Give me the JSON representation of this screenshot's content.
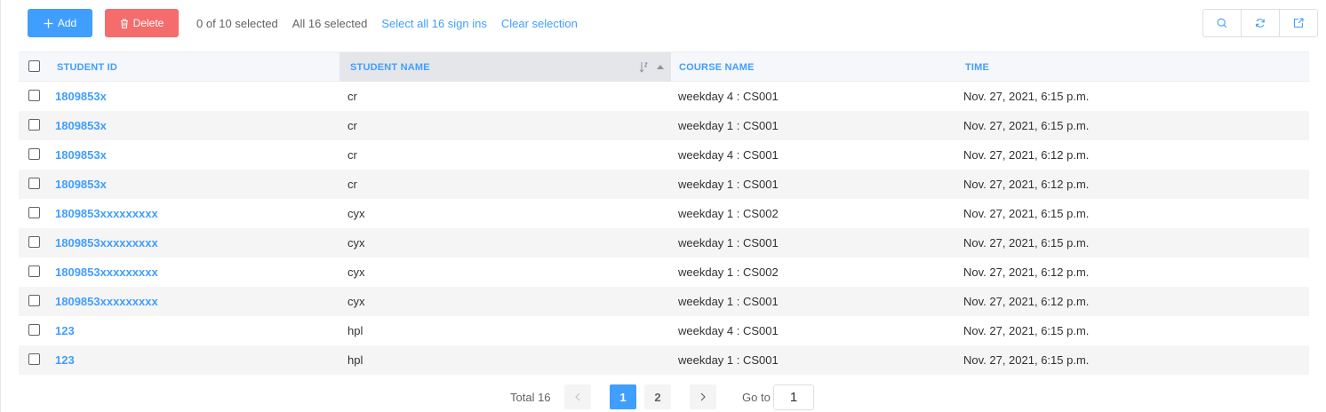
{
  "toolbar": {
    "add_label": "Add",
    "delete_label": "Delete",
    "selected_text": "0 of 10 selected",
    "all_selected_text": "All 16 selected",
    "select_all_link": "Select all 16 sign ins",
    "clear_link": "Clear selection",
    "tools": [
      "search-icon",
      "refresh-icon",
      "export-icon"
    ]
  },
  "table": {
    "columns": [
      "STUDENT ID",
      "STUDENT NAME",
      "COURSE NAME",
      "TIME"
    ],
    "sorted_column": "STUDENT NAME",
    "rows": [
      {
        "id": "1809853x",
        "name": "cr",
        "course": "weekday 4 : CS001",
        "time": "Nov. 27, 2021, 6:15 p.m."
      },
      {
        "id": "1809853x",
        "name": "cr",
        "course": "weekday 1 : CS001",
        "time": "Nov. 27, 2021, 6:15 p.m."
      },
      {
        "id": "1809853x",
        "name": "cr",
        "course": "weekday 4 : CS001",
        "time": "Nov. 27, 2021, 6:12 p.m."
      },
      {
        "id": "1809853x",
        "name": "cr",
        "course": "weekday 1 : CS001",
        "time": "Nov. 27, 2021, 6:12 p.m."
      },
      {
        "id": "1809853xxxxxxxxx",
        "name": "cyx",
        "course": "weekday 1 : CS002",
        "time": "Nov. 27, 2021, 6:15 p.m."
      },
      {
        "id": "1809853xxxxxxxxx",
        "name": "cyx",
        "course": "weekday 1 : CS001",
        "time": "Nov. 27, 2021, 6:15 p.m."
      },
      {
        "id": "1809853xxxxxxxxx",
        "name": "cyx",
        "course": "weekday 1 : CS002",
        "time": "Nov. 27, 2021, 6:12 p.m."
      },
      {
        "id": "1809853xxxxxxxxx",
        "name": "cyx",
        "course": "weekday 1 : CS001",
        "time": "Nov. 27, 2021, 6:12 p.m."
      },
      {
        "id": "123",
        "name": "hpl",
        "course": "weekday 4 : CS001",
        "time": "Nov. 27, 2021, 6:15 p.m."
      },
      {
        "id": "123",
        "name": "hpl",
        "course": "weekday 1 : CS001",
        "time": "Nov. 27, 2021, 6:15 p.m."
      }
    ]
  },
  "pagination": {
    "total_text": "Total 16",
    "pages": [
      "1",
      "2"
    ],
    "current_page": "1",
    "goto_label": "Go to",
    "goto_value": "1"
  },
  "colors": {
    "primary": "#409eff",
    "danger": "#f56c6c",
    "stripe": "#f5f5f5",
    "header_bg": "#f5f7fa"
  }
}
